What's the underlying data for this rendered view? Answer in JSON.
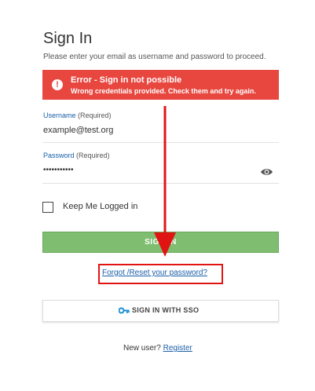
{
  "header": {
    "title": "Sign In",
    "subtitle": "Please enter your email as username and password to proceed."
  },
  "error": {
    "title": "Error - Sign in not possible",
    "message": "Wrong credentials provided. Check them and try again.",
    "icon": "exclamation-icon",
    "color": "#e8473f"
  },
  "username": {
    "label": "Username",
    "required": "(Required)",
    "value": "example@test.org"
  },
  "password": {
    "label": "Password",
    "required": "(Required)",
    "value": "•••••••••••",
    "toggle_icon": "eye-icon"
  },
  "remember": {
    "label": "Keep Me Logged in",
    "checked": false
  },
  "signin_button": {
    "label": "SIGN IN",
    "color": "#7fbd70"
  },
  "forgot": {
    "label": "Forgot /Reset your password?"
  },
  "sso_button": {
    "label": "SIGN IN WITH SSO",
    "icon": "key-icon"
  },
  "register": {
    "prompt": "New user?",
    "link": "Register"
  },
  "annotation": {
    "color": "#e11414"
  }
}
